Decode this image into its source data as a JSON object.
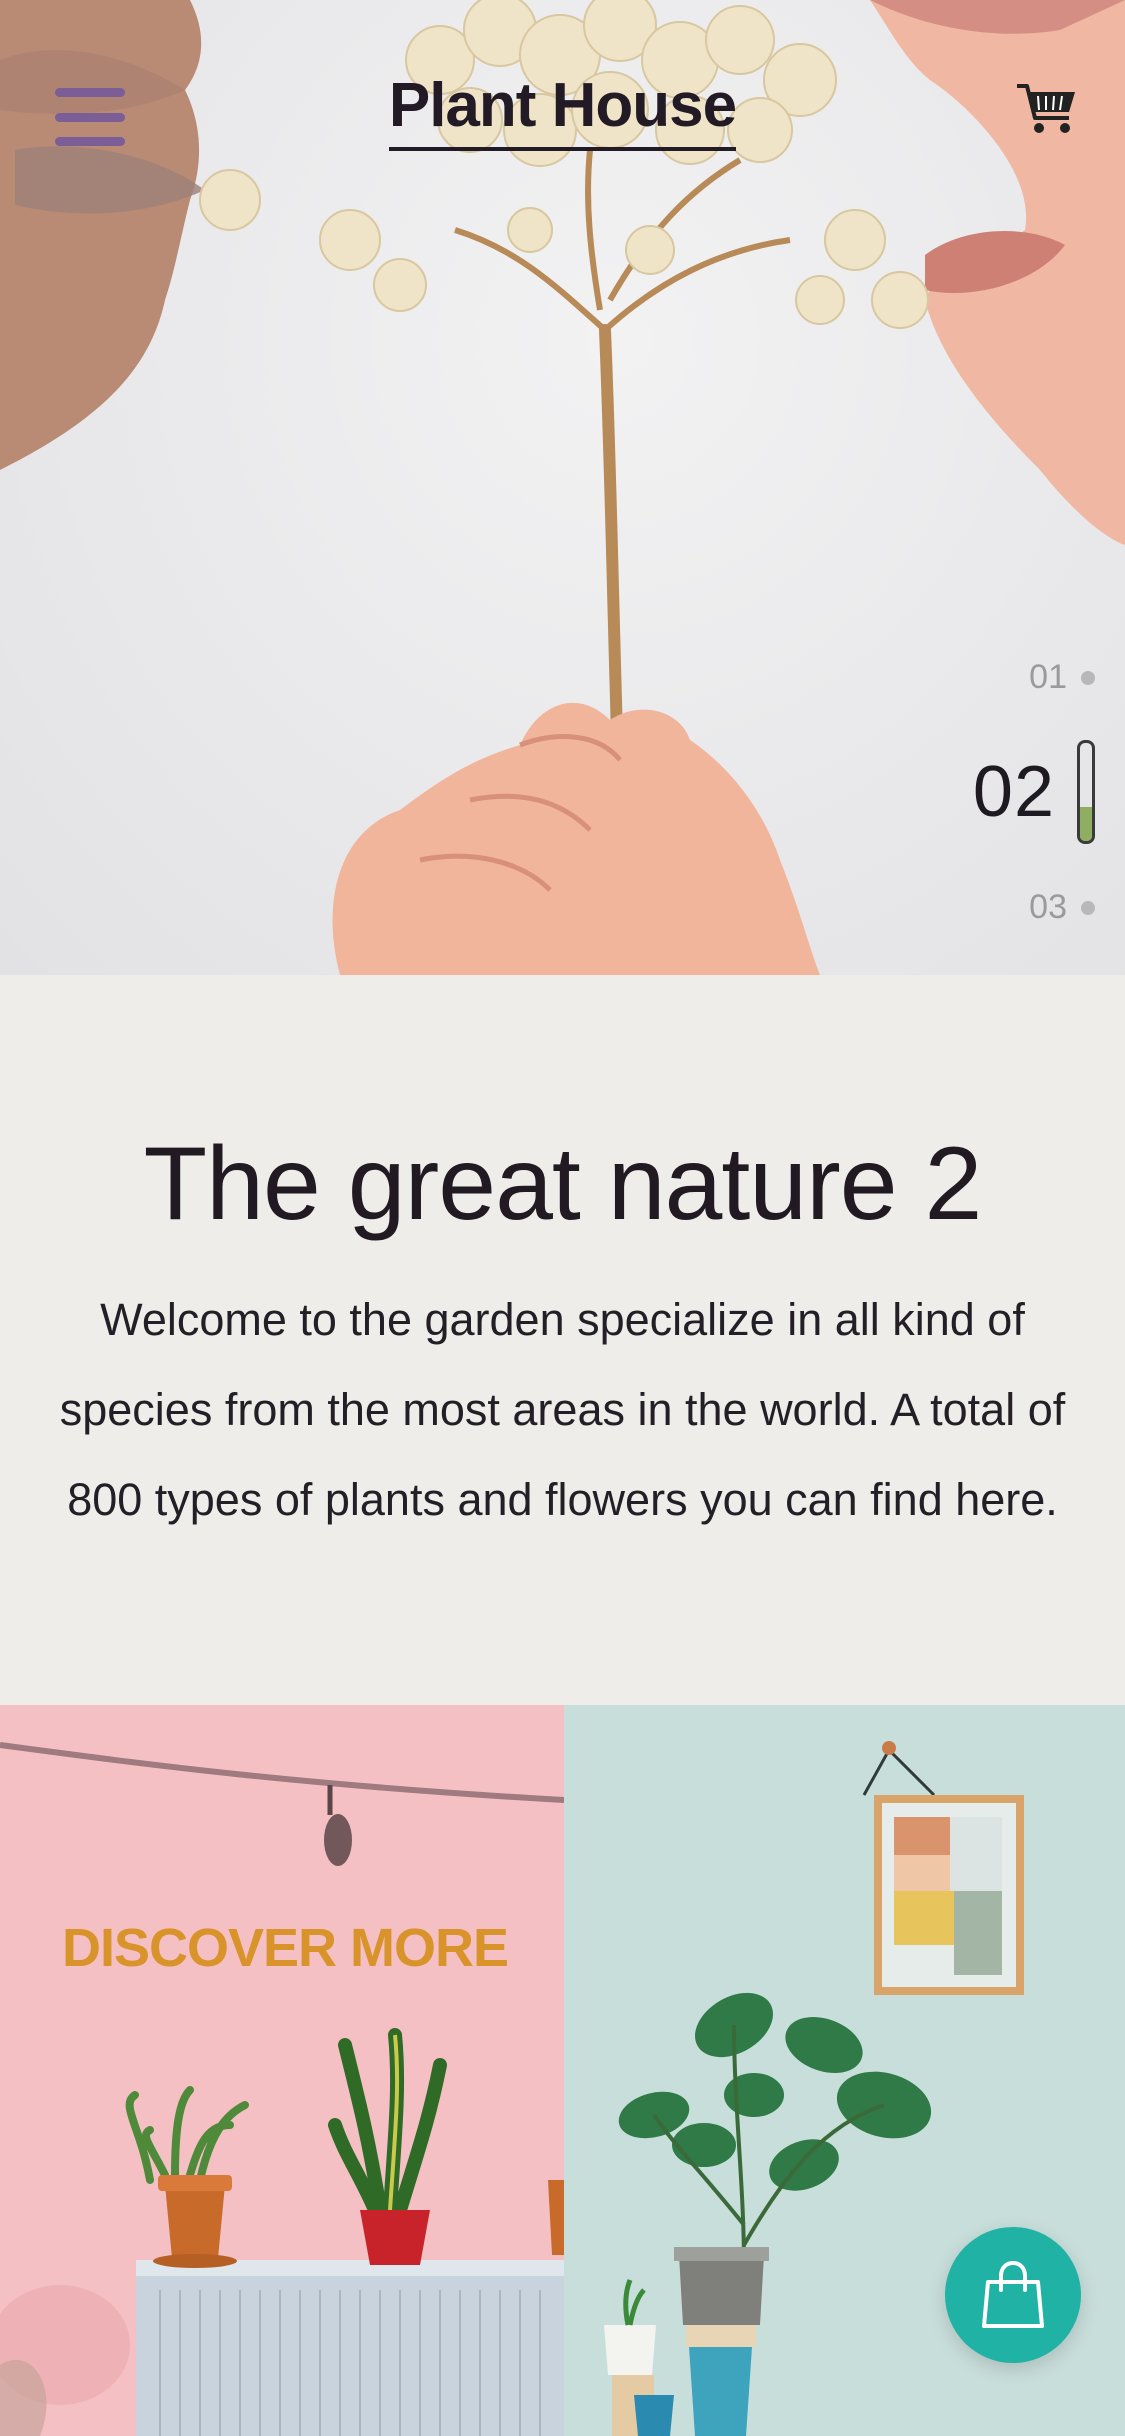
{
  "header": {
    "brand": "Plant House",
    "menu_icon": "hamburger-menu-icon",
    "cart_icon": "shopping-cart-icon",
    "menu_color": "#7a5e95"
  },
  "slider": {
    "items": [
      {
        "label": "01",
        "active": false
      },
      {
        "label": "02",
        "active": true
      },
      {
        "label": "03",
        "active": false
      }
    ],
    "progress": 0.35,
    "progress_color": "#8fae62"
  },
  "intro": {
    "title": "The great nature 2",
    "body": "Welcome to the garden specialize in all kind of species from the most areas in the world. A total of 800 types of plants and flowers you can find here."
  },
  "promo": {
    "discover_label": "DISCOVER MORE",
    "discover_color": "#d8932a"
  },
  "fab": {
    "icon": "shopping-bag-icon",
    "color": "#20b3a5"
  }
}
